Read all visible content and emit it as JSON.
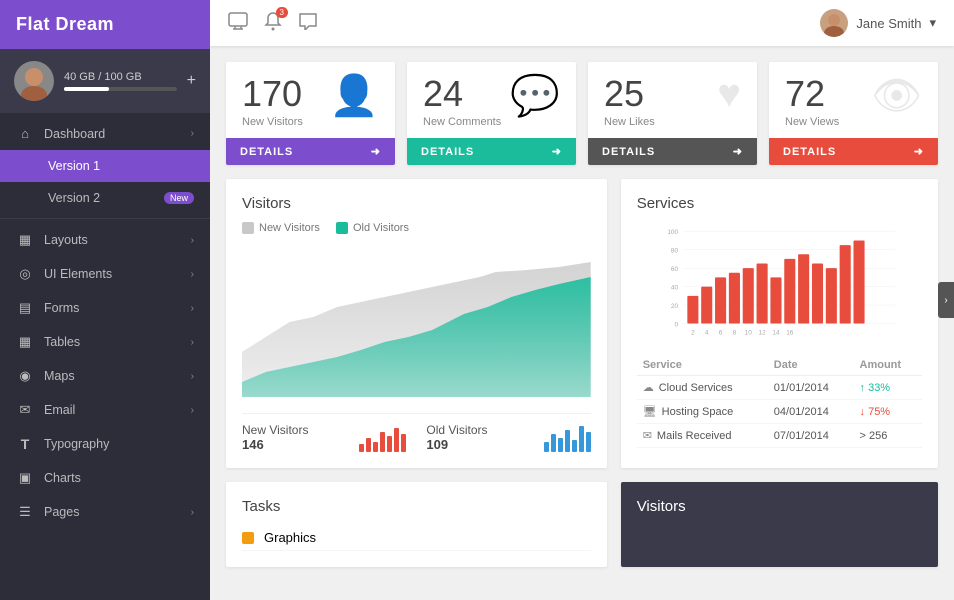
{
  "sidebar": {
    "brand": "Flat Dream",
    "user": {
      "storage_text": "40 GB / 100 GB",
      "storage_pct": 40
    },
    "items": [
      {
        "id": "dashboard",
        "label": "Dashboard",
        "icon": "⌂",
        "hasArrow": true,
        "active": false
      },
      {
        "id": "version1",
        "label": "Version 1",
        "icon": "",
        "sub": true,
        "active": true
      },
      {
        "id": "version2",
        "label": "Version 2",
        "icon": "",
        "sub": true,
        "badge": "New",
        "active": false
      },
      {
        "id": "layouts",
        "label": "Layouts",
        "icon": "▦",
        "hasArrow": true
      },
      {
        "id": "ui-elements",
        "label": "UI Elements",
        "icon": "◎",
        "hasArrow": true
      },
      {
        "id": "forms",
        "label": "Forms",
        "icon": "▤",
        "hasArrow": true
      },
      {
        "id": "tables",
        "label": "Tables",
        "icon": "▦",
        "hasArrow": true
      },
      {
        "id": "maps",
        "label": "Maps",
        "icon": "◉",
        "hasArrow": true
      },
      {
        "id": "email",
        "label": "Email",
        "icon": "✉",
        "hasArrow": true
      },
      {
        "id": "typography",
        "label": "Typography",
        "icon": "T",
        "hasArrow": false
      },
      {
        "id": "charts",
        "label": "Charts",
        "icon": "▣",
        "hasArrow": false
      },
      {
        "id": "pages",
        "label": "Pages",
        "icon": "☰",
        "hasArrow": true
      }
    ]
  },
  "topbar": {
    "icons": [
      {
        "id": "monitor",
        "symbol": "🖥",
        "badge": null
      },
      {
        "id": "bell",
        "symbol": "🔔",
        "badge": "3"
      },
      {
        "id": "chat",
        "symbol": "💬",
        "badge": null
      }
    ],
    "user": {
      "name": "Jane Smith",
      "arrow": "▾"
    }
  },
  "stats": [
    {
      "id": "visitors",
      "number": "170",
      "label": "New Visitors",
      "footer_label": "DETAILS",
      "footer_color": "purple",
      "icon": "👤"
    },
    {
      "id": "comments",
      "number": "24",
      "label": "New Comments",
      "footer_label": "DETAILS",
      "footer_color": "teal",
      "icon": "💬"
    },
    {
      "id": "likes",
      "number": "25",
      "label": "New Likes",
      "footer_label": "DETAILS",
      "footer_color": "dark",
      "icon": "♥"
    },
    {
      "id": "views",
      "number": "72",
      "label": "New Views",
      "footer_label": "DETAILS",
      "footer_color": "red",
      "icon": "👁"
    }
  ],
  "visitors_chart": {
    "title": "Visitors",
    "legend": [
      {
        "label": "New Visitors",
        "color": "gray"
      },
      {
        "label": "Old Visitors",
        "color": "teal"
      }
    ],
    "new_visitors": {
      "label": "New Visitors",
      "count": "146"
    },
    "old_visitors": {
      "label": "Old Visitors",
      "count": "109"
    }
  },
  "services": {
    "title": "Services",
    "chart_labels": [
      "2",
      "4",
      "6",
      "8",
      "10",
      "12",
      "14",
      "16"
    ],
    "chart_y": [
      "0",
      "20",
      "40",
      "60",
      "80",
      "100"
    ],
    "table": {
      "headers": [
        "Service",
        "Date",
        "Amount"
      ],
      "rows": [
        {
          "icon": "☁",
          "name": "Cloud Services",
          "date": "01/01/2014",
          "amount": "↑ 33%",
          "type": "up"
        },
        {
          "icon": "🖥",
          "name": "Hosting Space",
          "date": "04/01/2014",
          "amount": "↓ 75%",
          "type": "down"
        },
        {
          "icon": "✉",
          "name": "Mails Received",
          "date": "07/01/2014",
          "amount": "> 256",
          "type": "right"
        }
      ]
    }
  },
  "tasks": {
    "title": "Tasks",
    "items": [
      {
        "label": "Graphics",
        "color": "#f39c12"
      }
    ]
  },
  "visitors_small": {
    "title": "Visitors"
  },
  "sidebar_toggle": "‹"
}
